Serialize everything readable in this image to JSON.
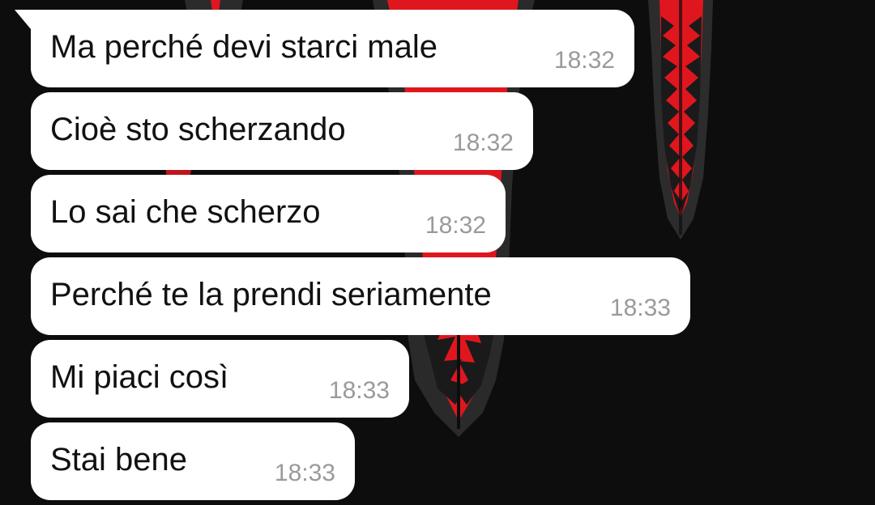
{
  "colors": {
    "background": "#0d0d0d",
    "wallpaper_accent": "#e0161f",
    "bubble": "#ffffff",
    "text": "#111111",
    "timestamp": "#9a9a9a"
  },
  "messages": [
    {
      "text": "Ma perché devi starci male",
      "time": "18:32"
    },
    {
      "text": "Cioè sto scherzando",
      "time": "18:32"
    },
    {
      "text": "Lo sai che scherzo",
      "time": "18:32"
    },
    {
      "text": "Perché te la prendi seriamente",
      "time": "18:33"
    },
    {
      "text": "Mi piaci così",
      "time": "18:33"
    },
    {
      "text": "Stai bene",
      "time": "18:33"
    }
  ]
}
